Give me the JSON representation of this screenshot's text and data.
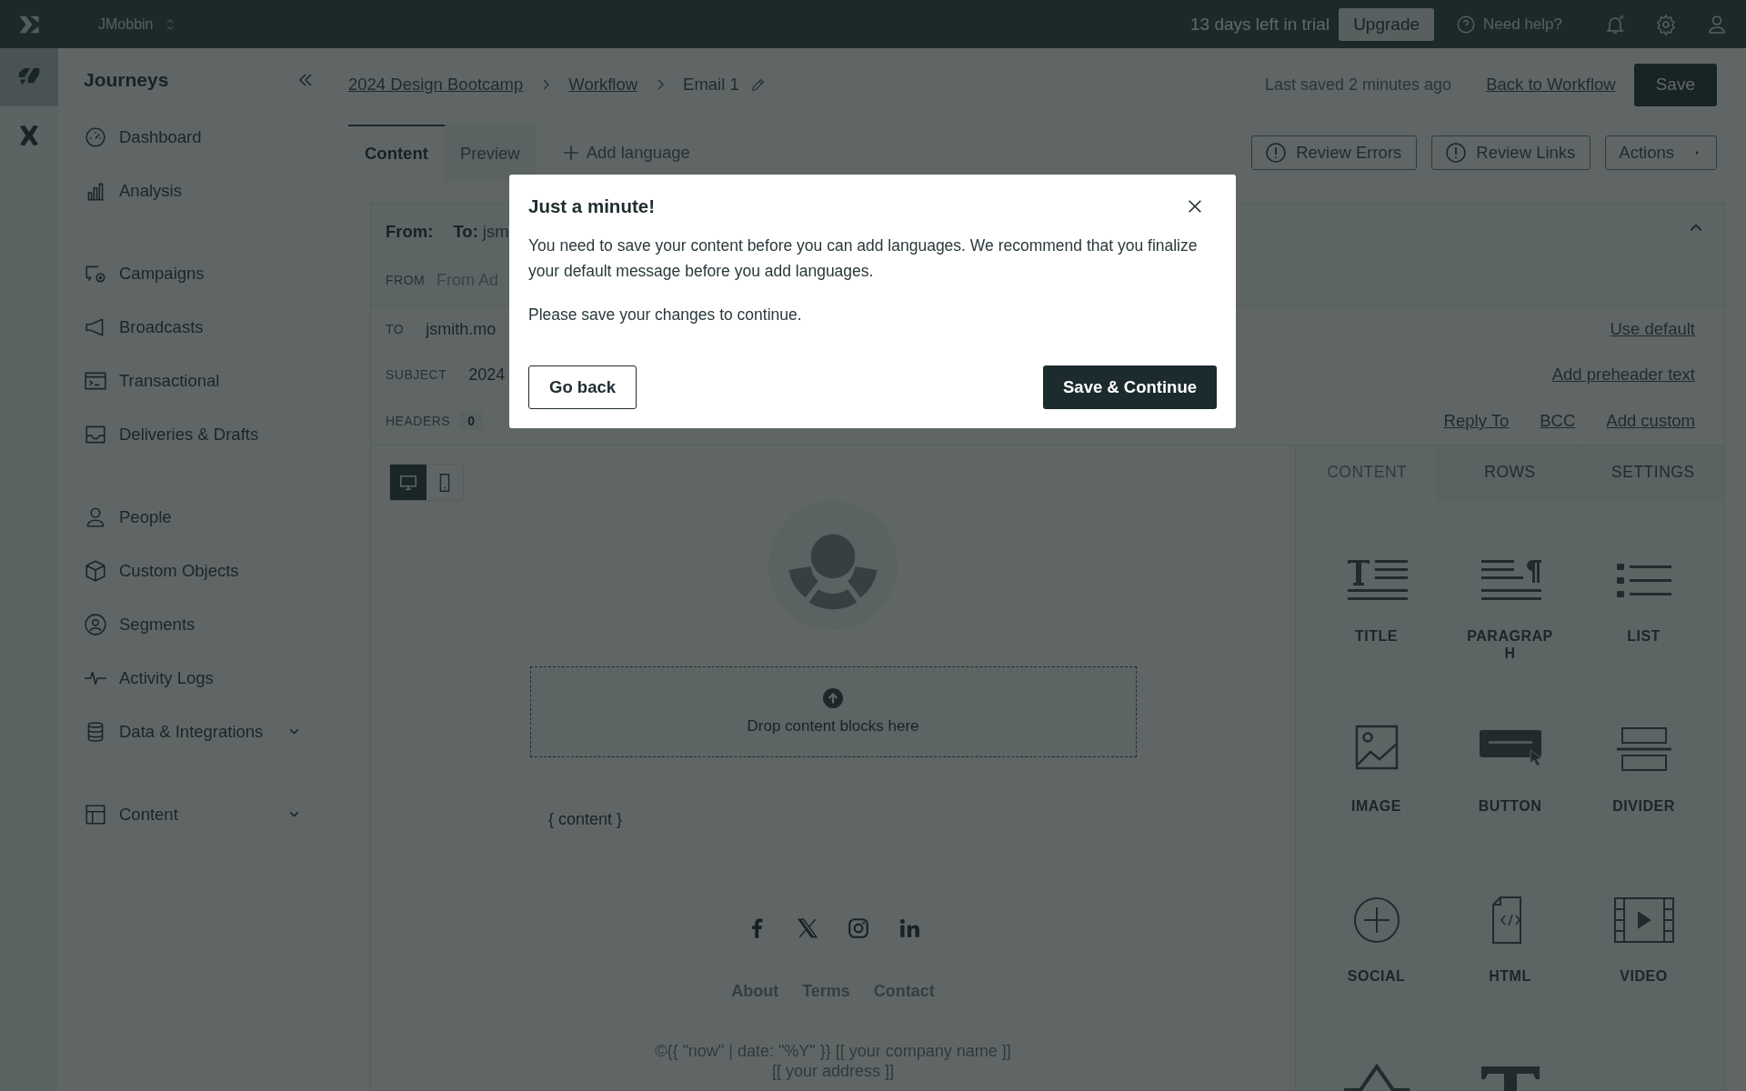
{
  "top_bar": {
    "workspace": "JMobbin",
    "trial": "13 days left in trial",
    "upgrade": "Upgrade",
    "help": "Need help?"
  },
  "rail": [
    {
      "selected": true
    },
    {
      "selected": false
    }
  ],
  "sidebar": {
    "title": "Journeys",
    "sections": [
      {
        "items": [
          {
            "label": "Dashboard",
            "expandable": false
          },
          {
            "label": "Analysis",
            "expandable": false
          }
        ]
      },
      {
        "items": [
          {
            "label": "Campaigns",
            "expandable": false
          },
          {
            "label": "Broadcasts",
            "expandable": false
          },
          {
            "label": "Transactional",
            "expandable": false
          },
          {
            "label": "Deliveries & Drafts",
            "expandable": false
          }
        ]
      },
      {
        "items": [
          {
            "label": "People",
            "expandable": false
          },
          {
            "label": "Custom Objects",
            "expandable": false
          },
          {
            "label": "Segments",
            "expandable": false
          },
          {
            "label": "Activity Logs",
            "expandable": false
          },
          {
            "label": "Data & Integrations",
            "expandable": true
          }
        ]
      },
      {
        "items": [
          {
            "label": "Content",
            "expandable": true
          }
        ]
      }
    ]
  },
  "breadcrumbs": [
    "2024 Design Bootcamp",
    "Workflow",
    "Email 1"
  ],
  "last_saved": "Last saved 2 minutes ago",
  "back_link": "Back to Workflow",
  "save_button": "Save",
  "editor_tabs": [
    {
      "label": "Content",
      "selected": true
    },
    {
      "label": "Preview",
      "selected": false
    }
  ],
  "add_language": "Add language",
  "toolbar_buttons": [
    {
      "label": "Review Errors",
      "kind": "warning"
    },
    {
      "label": "Review Links",
      "kind": "warning"
    },
    {
      "label": "Actions",
      "kind": "dropdown"
    }
  ],
  "email_header": {
    "from_label": "From:",
    "to_label": "To:",
    "to_value": "jsm",
    "from_field": {
      "label": "FROM",
      "placeholder": "From Ad"
    },
    "rows": [
      {
        "label": "TO",
        "value": "jsmith.mo",
        "links": [
          "Use default"
        ]
      },
      {
        "label": "SUBJECT",
        "value": "2024",
        "links": [
          "Add preheader text"
        ]
      },
      {
        "label": "HEADERS",
        "count": "0",
        "links": [
          "Reply To",
          "BCC",
          "Add custom"
        ]
      }
    ]
  },
  "view_toggle": [
    {
      "selected": true
    },
    {
      "selected": false
    }
  ],
  "canvas": {
    "drop_text": "Drop content blocks here",
    "content_placeholder": "{ content }",
    "footer_links": [
      "About",
      "Terms",
      "Contact"
    ],
    "footer_lines": [
      "©{{ \"now\" | date: \"%Y\" }} [[ your company name ]]",
      "[[ your address ]]"
    ]
  },
  "panel": {
    "tabs": [
      {
        "label": "CONTENT",
        "selected": true
      },
      {
        "label": "ROWS",
        "selected": false
      },
      {
        "label": "SETTINGS",
        "selected": false
      }
    ],
    "blocks": [
      {
        "kind": "title",
        "label": "TITLE"
      },
      {
        "kind": "paragraph",
        "label": "PARAGRAPH"
      },
      {
        "kind": "list",
        "label": "LIST"
      },
      {
        "kind": "image",
        "label": "IMAGE"
      },
      {
        "kind": "button",
        "label": "BUTTON"
      },
      {
        "kind": "divider",
        "label": "DIVIDER"
      },
      {
        "kind": "social",
        "label": "SOCIAL"
      },
      {
        "kind": "html",
        "label": "HTML"
      },
      {
        "kind": "video",
        "label": "VIDEO"
      },
      {
        "kind": "peak"
      },
      {
        "kind": "text"
      }
    ]
  },
  "modal": {
    "title": "Just a minute!",
    "paragraphs": [
      "You need to save your content before you can add languages. We recommend that you finalize your default message before you add languages.",
      "Please save your changes to continue."
    ],
    "secondary_button": "Go back",
    "primary_button": "Save & Continue"
  }
}
